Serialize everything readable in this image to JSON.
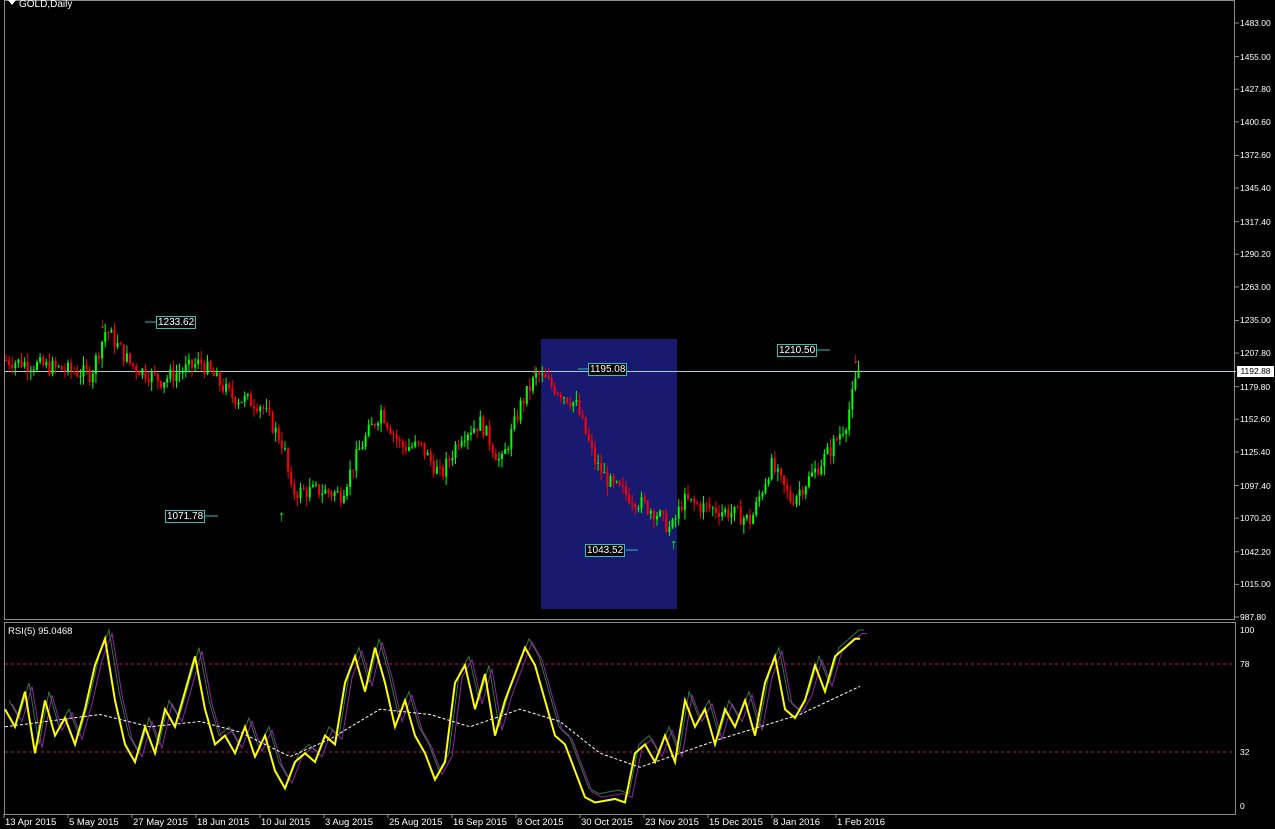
{
  "window": {
    "title": "GOLD,Daily"
  },
  "price_axis": {
    "labels": [
      "1483.00",
      "1455.00",
      "1427.80",
      "1400.60",
      "1372.60",
      "1345.40",
      "1317.40",
      "1290.20",
      "1263.00",
      "1235.00",
      "1207.80",
      "1179.80",
      "1152.60",
      "1125.40",
      "1097.40",
      "1070.20",
      "1042.20",
      "1015.00",
      "987.80"
    ],
    "current": "1192.88"
  },
  "rsi": {
    "title": "RSI(5) 95.0468",
    "levels": [
      "100",
      "78",
      "32",
      "0"
    ]
  },
  "time_axis": {
    "labels": [
      "13 Apr 2015",
      "5 May 2015",
      "27 May 2015",
      "18 Jun 2015",
      "10 Jul 2015",
      "3 Aug 2015",
      "25 Aug 2015",
      "16 Sep 2015",
      "8 Oct 2015",
      "30 Oct 2015",
      "23 Nov 2015",
      "15 Dec 2015",
      "8 Jan 2016",
      "1 Feb 2016"
    ]
  },
  "annotations": {
    "high1": "1233.62",
    "low1": "1071.78",
    "high2": "1195.08",
    "low2": "1043.52",
    "high3": "1210.50"
  },
  "colors": {
    "background": "#000000",
    "bull": "#00ff00",
    "bear": "#ff0000",
    "rsi_line": "#ffff00",
    "highlight": "#191970",
    "price_line": "#a9cfd8",
    "label_border": "#2fc0c0"
  },
  "icons": {
    "down": "red-down-arrow-icon",
    "up": "green-up-arrow-icon"
  },
  "chart_data": {
    "type": "line",
    "title": "GOLD,Daily",
    "x": [
      "13 Apr 2015",
      "5 May 2015",
      "27 May 2015",
      "18 Jun 2015",
      "10 Jul 2015",
      "3 Aug 2015",
      "25 Aug 2015",
      "16 Sep 2015",
      "8 Oct 2015",
      "30 Oct 2015",
      "23 Nov 2015",
      "15 Dec 2015",
      "8 Jan 2016",
      "1 Feb 2016"
    ],
    "series": [
      {
        "values": [
          1205,
          1225,
          1185,
          1195,
          1100,
          1090,
          1140,
          1130,
          1180,
          1140,
          1065,
          1070,
          1090,
          1192.88
        ]
      }
    ],
    "ylim": [
      987.8,
      1483.0
    ],
    "rsi_ylim": [
      0,
      100
    ]
  }
}
